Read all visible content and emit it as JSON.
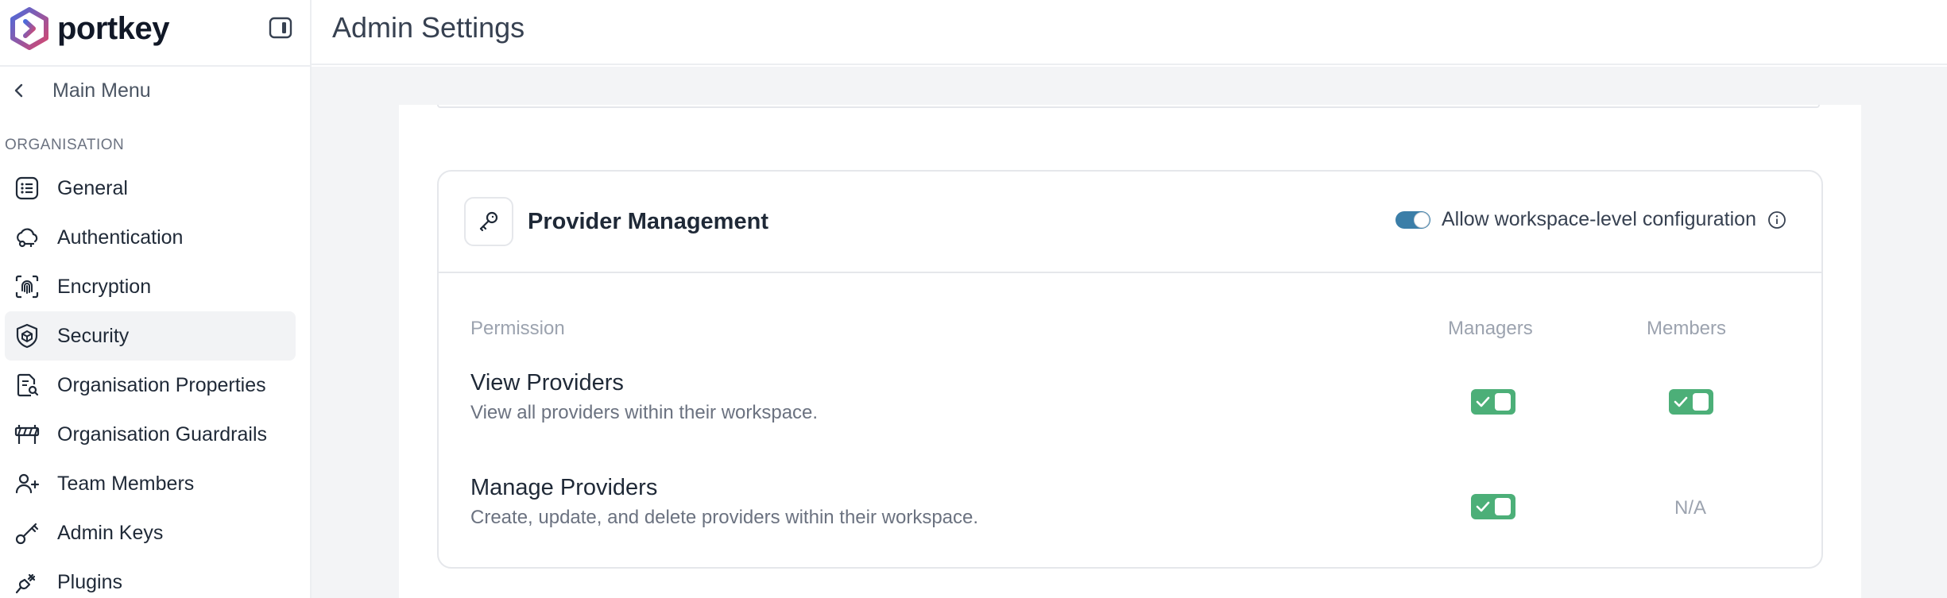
{
  "brand": {
    "name": "portkey"
  },
  "header": {
    "title": "Admin Settings"
  },
  "sidebar": {
    "back_label": "Main Menu",
    "section_label": "ORGANISATION",
    "items": [
      {
        "label": "General",
        "icon": "list-icon"
      },
      {
        "label": "Authentication",
        "icon": "cloud-key-icon"
      },
      {
        "label": "Encryption",
        "icon": "fingerprint-icon"
      },
      {
        "label": "Security",
        "icon": "shield-icon",
        "active": true
      },
      {
        "label": "Organisation Properties",
        "icon": "document-search-icon"
      },
      {
        "label": "Organisation Guardrails",
        "icon": "barrier-icon"
      },
      {
        "label": "Team Members",
        "icon": "users-add-icon"
      },
      {
        "label": "Admin Keys",
        "icon": "key-icon"
      },
      {
        "label": "Plugins",
        "icon": "plug-icon"
      }
    ]
  },
  "card": {
    "title": "Provider Management",
    "toggle_label": "Allow workspace-level configuration",
    "toggle_on": true,
    "columns": {
      "permission": "Permission",
      "managers": "Managers",
      "members": "Members"
    },
    "rows": [
      {
        "title": "View Providers",
        "desc": "View all providers within their workspace.",
        "managers": true,
        "members": true
      },
      {
        "title": "Manage Providers",
        "desc": "Create, update, and delete providers within their workspace.",
        "managers": true,
        "members_text": "N/A"
      }
    ]
  },
  "colors": {
    "accent_toggle": "#3b7ea8",
    "check_green": "#4caf78"
  }
}
